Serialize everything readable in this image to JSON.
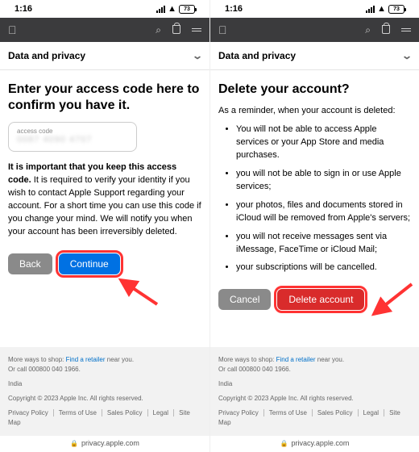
{
  "status": {
    "time": "1:16",
    "battery": "73"
  },
  "nav": {
    "section": "Data and privacy"
  },
  "left": {
    "heading": "Enter your access code here to confirm you have it.",
    "field_label": "access code",
    "field_masked": "0087 4090 4707",
    "bold_line": "It is important that you keep this access code.",
    "body": " It is required to verify your identity if you wish to contact Apple Support regarding your account. For a short time you can use this code if you change your mind. We will notify you when your account has been irreversibly deleted.",
    "back": "Back",
    "continue": "Continue"
  },
  "right": {
    "heading": "Delete your account?",
    "reminder": "As a reminder, when your account is deleted:",
    "bullets": [
      "You will not be able to access Apple services or your App Store and media purchases.",
      "you will not be able to sign in or use Apple services;",
      "your photos, files and documents stored in iCloud will be removed from Apple's servers;",
      "you will not receive messages sent via iMessage, FaceTime or iCloud Mail;",
      "your subscriptions will be cancelled."
    ],
    "cancel": "Cancel",
    "delete": "Delete account"
  },
  "footer": {
    "ways_pre": "More ways to shop: ",
    "retailer": "Find a retailer",
    "ways_post": " near you.",
    "call": "Or call 000800 040 1966.",
    "country": "India",
    "copyright": "Copyright © 2023 Apple Inc. All rights reserved.",
    "links": [
      "Privacy Policy",
      "Terms of Use",
      "Sales Policy",
      "Legal",
      "Site Map"
    ]
  },
  "url": "privacy.apple.com"
}
